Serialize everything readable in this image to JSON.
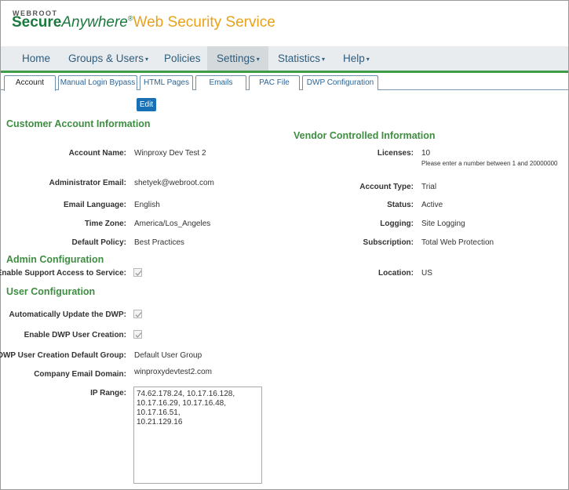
{
  "brand": {
    "top": "WEBROOT",
    "secure": "Secure",
    "anywhere": "Anywhere",
    "reg": "®",
    "service": "Web Security Service"
  },
  "nav": {
    "home": "Home",
    "groups_users": "Groups & Users",
    "policies": "Policies",
    "settings": "Settings",
    "statistics": "Statistics",
    "help": "Help",
    "caret": "▾"
  },
  "tabs": {
    "account": "Account",
    "manual_login_bypass": "Manual Login Bypass",
    "html_pages": "HTML Pages",
    "emails": "Emails",
    "pac_file": "PAC File",
    "dwp_configuration": "DWP Configuration"
  },
  "edit_label": "Edit",
  "customer": {
    "title": "Customer Account Information",
    "account_name_label": "Account Name:",
    "account_name": "Winproxy Dev Test 2",
    "admin_email_label": "Administrator Email:",
    "admin_email": "shetyek@webroot.com",
    "email_language_label": "Email Language:",
    "email_language": "English",
    "time_zone_label": "Time Zone:",
    "time_zone": "America/Los_Angeles",
    "default_policy_label": "Default Policy:",
    "default_policy": "Best Practices"
  },
  "vendor": {
    "title": "Vendor Controlled Information",
    "licenses_label": "Licenses:",
    "licenses": "10",
    "licenses_hint": "Please enter a number between 1 and 20000000",
    "account_type_label": "Account Type:",
    "account_type": "Trial",
    "status_label": "Status:",
    "status": "Active",
    "logging_label": "Logging:",
    "logging": "Site Logging",
    "subscription_label": "Subscription:",
    "subscription": "Total Web Protection",
    "location_label": "Location:",
    "location": "US"
  },
  "admin": {
    "title": "Admin Configuration",
    "support_access_label": "Enable Support Access to Service:",
    "support_access_checked": true
  },
  "user": {
    "title": "User Configuration",
    "auto_update_label": "Automatically Update the DWP:",
    "auto_update_checked": true,
    "dwp_user_creation_label": "Enable DWP User Creation:",
    "dwp_user_creation_checked": true,
    "default_group_label": "DWP User Creation Default Group:",
    "default_group": "Default User Group",
    "company_domain_label": "Company Email Domain:",
    "company_domain": "winproxydevtest2.com",
    "ip_range_label": "IP Range:",
    "ip_range": "74.62.178.24, 10.17.16.128,\n10.17.16.29, 10.17.16.48, 10.17.16.51,\n10.21.129.16"
  }
}
